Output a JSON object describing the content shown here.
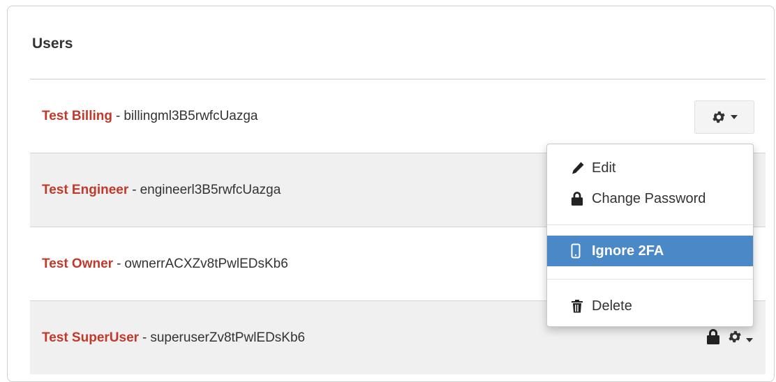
{
  "panel": {
    "title": "Users"
  },
  "users": [
    {
      "name": "Test Billing",
      "separator": "-",
      "username": "billingml3B5rwfcUazga"
    },
    {
      "name": "Test Engineer",
      "separator": "-",
      "username": "engineerl3B5rwfcUazga"
    },
    {
      "name": "Test Owner",
      "separator": "-",
      "username": "ownerrACXZv8tPwlEDsKb6"
    },
    {
      "name": "Test SuperUser",
      "separator": "-",
      "username": "superuserZv8tPwlEDsKb6"
    }
  ],
  "dropdown": {
    "items": [
      {
        "label": "Edit",
        "icon": "pencil-icon"
      },
      {
        "label": "Change Password",
        "icon": "lock-icon"
      },
      {
        "label": "Ignore 2FA",
        "icon": "phone-icon",
        "active": true
      },
      {
        "label": "Delete",
        "icon": "trash-icon"
      }
    ]
  },
  "colors": {
    "name_red": "#c0392b",
    "active_blue": "#4a88c7"
  }
}
